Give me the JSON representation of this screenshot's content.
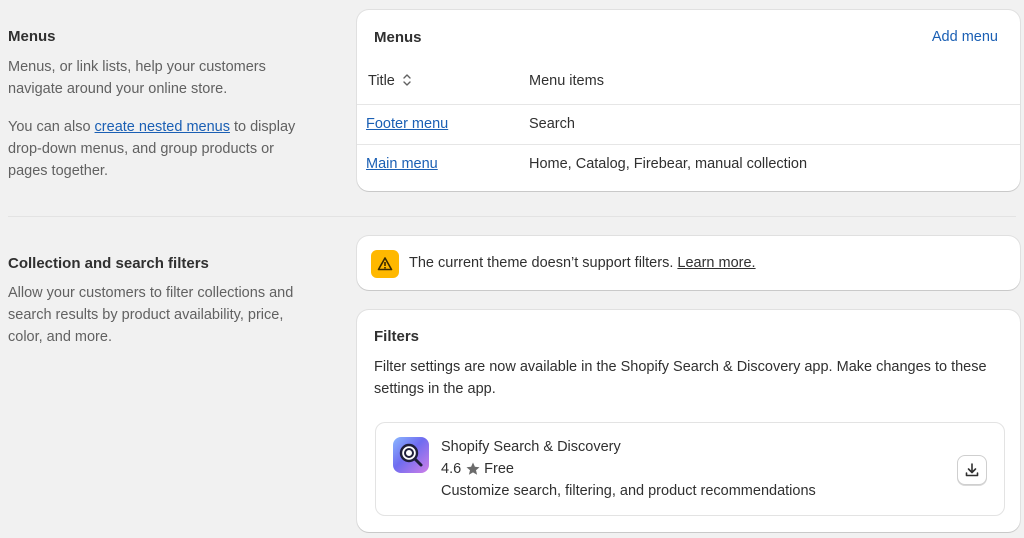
{
  "menus_section": {
    "title": "Menus",
    "desc1": "Menus, or link lists, help your customers navigate around your online store.",
    "desc2_prefix": "You can also ",
    "desc2_link": "create nested menus",
    "desc2_suffix": " to display drop-down menus, and group products or pages together."
  },
  "menus_card": {
    "title": "Menus",
    "add_menu_label": "Add menu",
    "columns": {
      "title": "Title",
      "items": "Menu items"
    },
    "rows": [
      {
        "title": "Footer menu",
        "items": "Search"
      },
      {
        "title": "Main menu",
        "items": "Home, Catalog, Firebear, manual collection"
      }
    ]
  },
  "filters_section": {
    "title": "Collection and search filters",
    "desc": "Allow your customers to filter collections and search results by product availability, price, color, and more."
  },
  "warning_banner": {
    "text": "The current theme doesn’t support filters. ",
    "link": "Learn more."
  },
  "filters_card": {
    "title": "Filters",
    "desc": "Filter settings are now available in the Shopify Search & Discovery app. Make changes to these settings in the app.",
    "app": {
      "name": "Shopify Search & Discovery",
      "rating": "4.6",
      "price": "Free",
      "description": "Customize search, filtering, and product recommendations",
      "icon": "search-discovery-app-icon",
      "action_icon": "download-icon"
    }
  },
  "colors": {
    "link": "#1a5fb4",
    "warning": "#ffb800",
    "background": "#f1f1f1"
  }
}
